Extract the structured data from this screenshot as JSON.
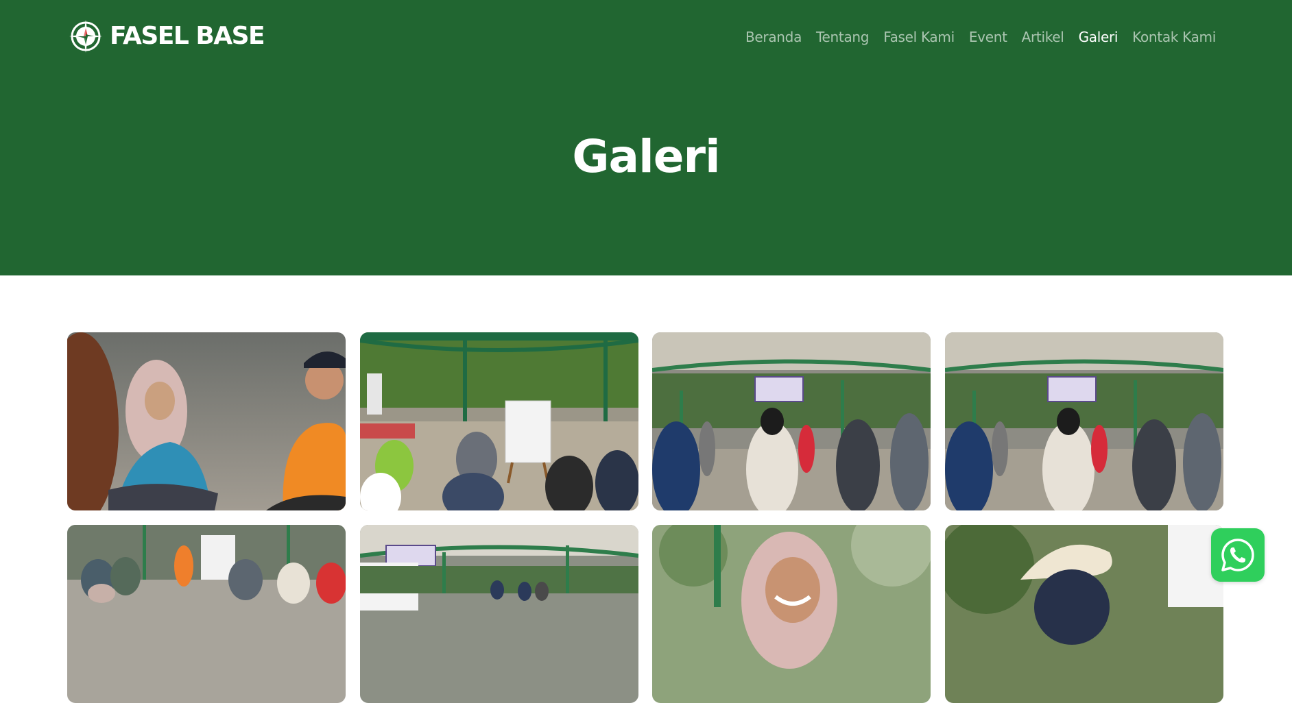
{
  "brand": {
    "name": "FASEL BASE",
    "icon": "compass-icon"
  },
  "nav": {
    "items": [
      {
        "label": "Beranda",
        "active": false
      },
      {
        "label": "Tentang",
        "active": false
      },
      {
        "label": "Fasel Kami",
        "active": false
      },
      {
        "label": "Event",
        "active": false
      },
      {
        "label": "Artikel",
        "active": false
      },
      {
        "label": "Galeri",
        "active": true
      },
      {
        "label": "Kontak Kami",
        "active": false
      }
    ]
  },
  "hero": {
    "title": "Galeri"
  },
  "gallery": {
    "photos": [
      {
        "subject": "Participants laughing, seated on floor"
      },
      {
        "subject": "Group seated in circle around whiteboard under canopy"
      },
      {
        "subject": "Participants standing in circle under tent with FASEL BASE banner"
      },
      {
        "subject": "Participants standing in circle under tent with FASEL BASE banner"
      },
      {
        "subject": "Facilitator with flipchart and group seated on wet floor"
      },
      {
        "subject": "Tent area with FASEL BASE banner and whiteboard"
      },
      {
        "subject": "Smiling woman in hijab"
      },
      {
        "subject": "Person in cream cap near flipchart"
      }
    ]
  },
  "whatsapp": {
    "icon": "whatsapp-icon"
  },
  "colors": {
    "header_bg": "#216631",
    "whatsapp_bg": "#2fcf5c",
    "nav_text": "#ffffffa0",
    "nav_active": "#ffffff"
  }
}
